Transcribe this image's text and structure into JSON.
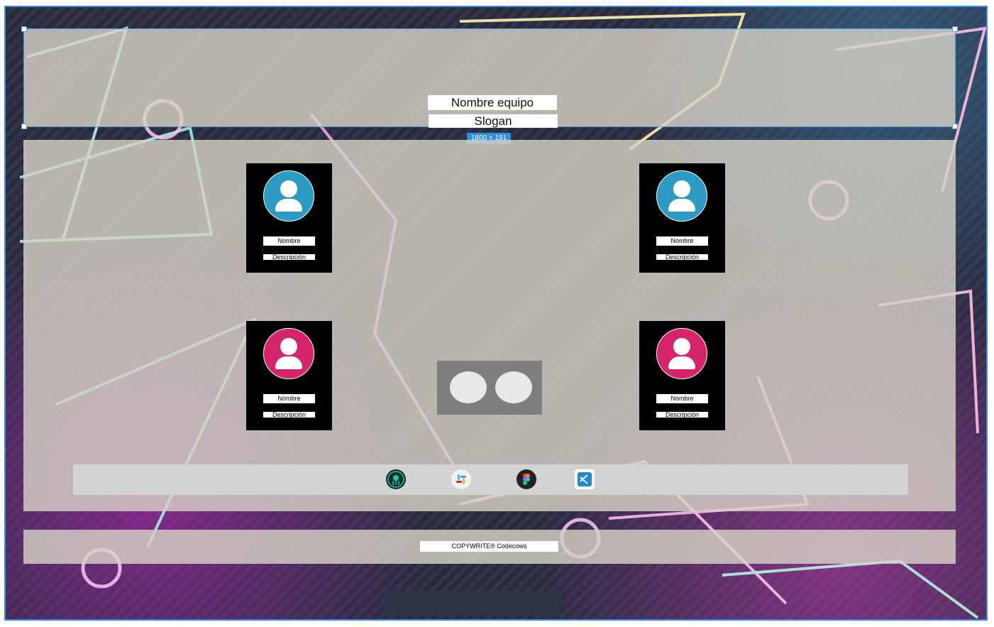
{
  "header": {
    "team_name": "Nombre equipo",
    "slogan": "Slogan",
    "dimension_badge": "1800 × 191"
  },
  "members": [
    {
      "name": "Nombre",
      "description": "Descripción",
      "avatar_color": "#2c9bc4"
    },
    {
      "name": "Nombre",
      "description": "Descripción",
      "avatar_color": "#2c9bc4"
    },
    {
      "name": "Nombre",
      "description": "Descripción",
      "avatar_color": "#d6246b"
    },
    {
      "name": "Nombre",
      "description": "Descripción",
      "avatar_color": "#d6246b"
    }
  ],
  "tools": [
    {
      "icon": "gitkraken-icon"
    },
    {
      "icon": "slack-icon"
    },
    {
      "icon": "figma-icon"
    },
    {
      "icon": "vscode-icon"
    }
  ],
  "footer": {
    "copyright": "COPYWRITE®  Codecows"
  },
  "colors": {
    "selection": "#3b8fe0",
    "panel": "#d7d2c6",
    "card": "#000000",
    "avatar_blue": "#2c9bc4",
    "avatar_pink": "#d6246b"
  }
}
